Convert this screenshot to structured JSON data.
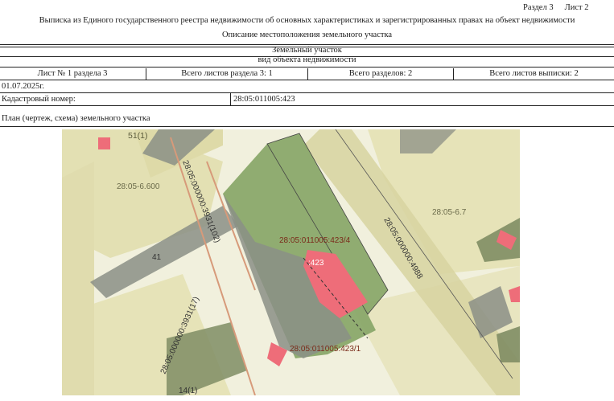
{
  "header": {
    "section": "Раздел 3",
    "sheet": "Лист 2"
  },
  "title": "Выписка из Единого государственного реестра недвижимости об основных характеристиках и зарегистрированных правах на объект недвижимости",
  "subtitle": "Описание местоположения земельного участка",
  "object_type": "Земельный участок",
  "object_type_caption": "вид объекта недвижимости",
  "sheet_info": {
    "sheet_number": "Лист № 1 раздела 3",
    "total_sheets_section": "Всего листов раздела 3: 1",
    "total_sections": "Всего разделов: 2",
    "total_sheets_extract": "Всего листов выписки: 2"
  },
  "date": "01.07.2025г.",
  "cadastral": {
    "label": "Кадастровый номер:",
    "value": "28:05:011005:423"
  },
  "plan_caption": "План (чертеж, схема) земельного участка",
  "map_labels": {
    "l1": "51(1)",
    "l2": "28:05-6.600",
    "l3": "28:05:000000:3931(102)",
    "l4": "28:05:011005:423/4",
    "l5": ":423",
    "l6": "28:05:000000:4988",
    "l7": "28:05-6.7",
    "l8": "41",
    "l9": "28:05:000000:3931(17)",
    "l10": "28:05:011005:423/1",
    "l11": "14(1)"
  },
  "colors": {
    "parcel_green": "#8aa86a",
    "parcel_grey": "#8b8f86",
    "building_pink": "#ee6d79",
    "zone_beige": "#e6e3bf"
  }
}
